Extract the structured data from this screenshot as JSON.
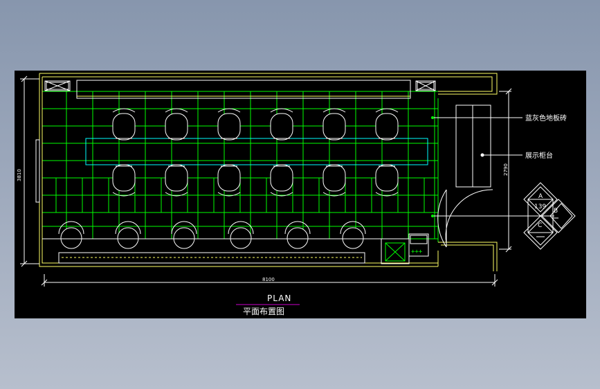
{
  "drawing": {
    "title": "PLAN",
    "subtitle": "平面布置图",
    "width_dim": "8100",
    "height_dim_left": "3810",
    "height_dim_right": "2790",
    "annotations": {
      "floor": "蓝灰色地板砖",
      "cabinet": "展示柜台"
    },
    "elevation_marker": {
      "top": "A",
      "right": "B",
      "bottom": "C",
      "sheet": "139"
    }
  },
  "colors": {
    "background": "#000000",
    "wall": "#ffff66",
    "floor_grid": "#00ff00",
    "furniture": "#ffffff",
    "table": "#00ffff",
    "title_underline": "#cc00cc"
  }
}
